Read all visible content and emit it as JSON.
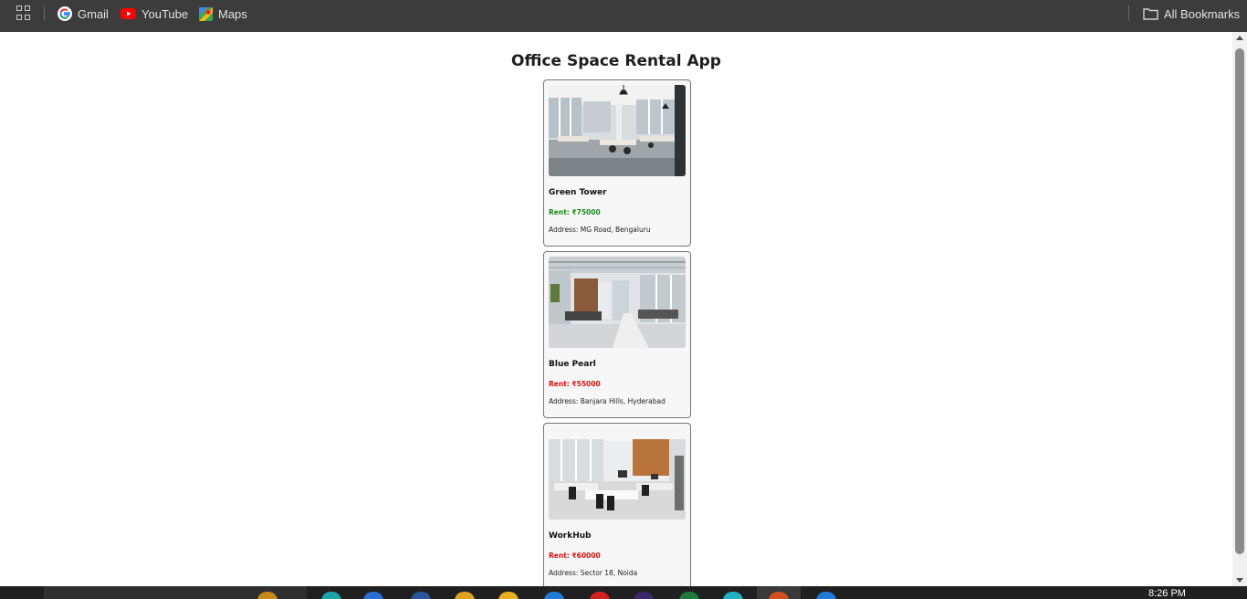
{
  "bookmarks_bar": {
    "items": [
      {
        "label": "Gmail",
        "icon": "google-icon"
      },
      {
        "label": "YouTube",
        "icon": "youtube-icon"
      },
      {
        "label": "Maps",
        "icon": "maps-icon"
      }
    ],
    "all_bookmarks_label": "All Bookmarks"
  },
  "page": {
    "title": "Office Space Rental App",
    "offices": [
      {
        "name": "Green Tower",
        "rent": "Rent: ₹75000",
        "address": "Address: MG Road, Bengaluru",
        "rent_color": "#1a8a1a"
      },
      {
        "name": "Blue Pearl",
        "rent": "Rent: ₹55000",
        "address": "Address: Banjara Hills, Hyderabad",
        "rent_color": "#e01010"
      },
      {
        "name": "WorkHub",
        "rent": "Rent: ₹60000",
        "address": "Address: Sector 18, Noida",
        "rent_color": "#e01010"
      }
    ]
  },
  "taskbar": {
    "clock": "8:26 PM"
  }
}
